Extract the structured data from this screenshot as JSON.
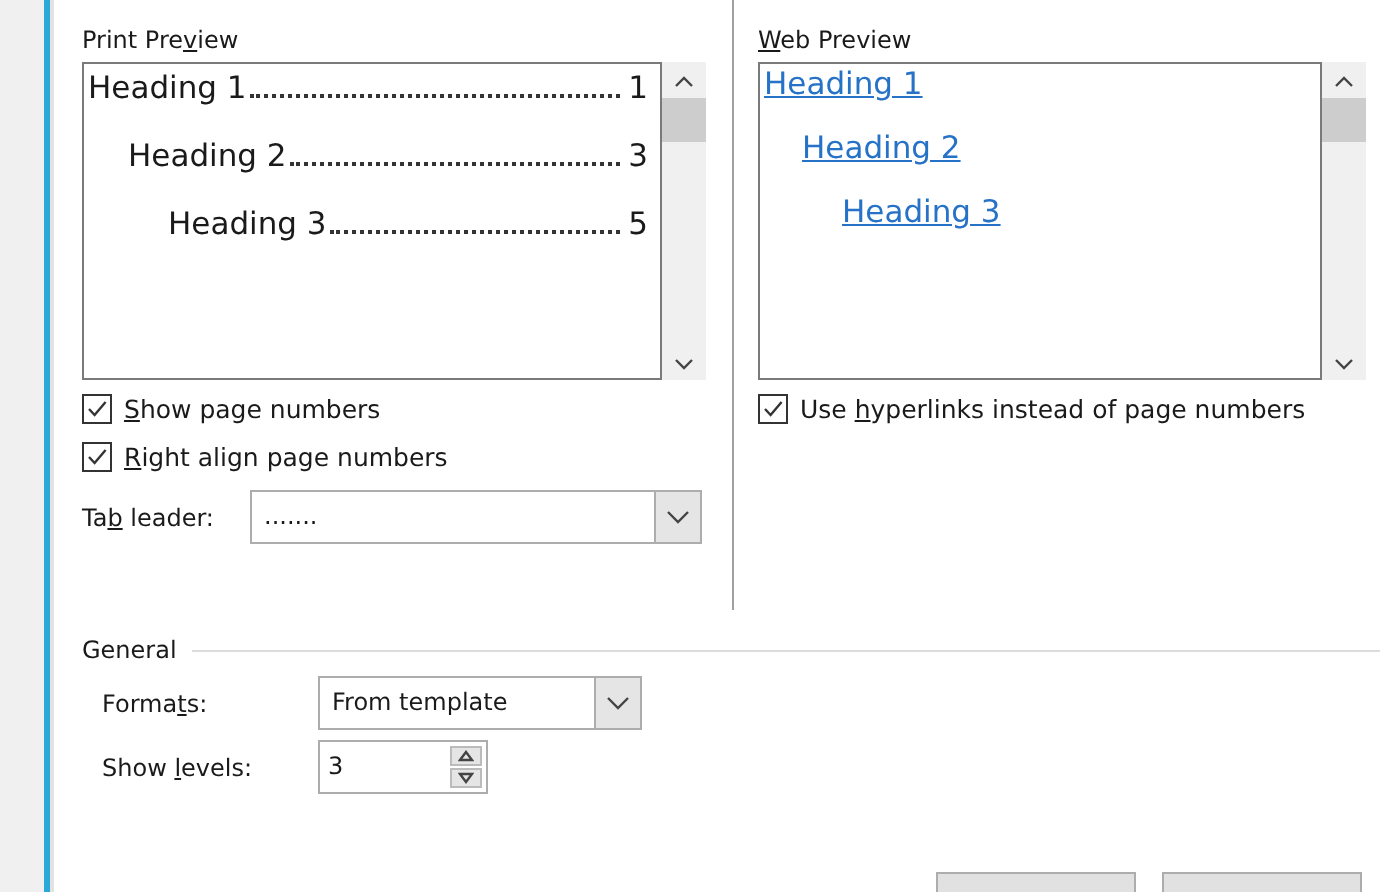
{
  "print_preview": {
    "label": {
      "before": "Print Pre",
      "key": "v",
      "after": "iew"
    },
    "entries": [
      {
        "text": "Heading 1",
        "page": "1"
      },
      {
        "text": "Heading 2",
        "page": "3"
      },
      {
        "text": "Heading 3",
        "page": "5"
      }
    ]
  },
  "print_options": [
    {
      "label": {
        "key": "S",
        "after": "how page numbers"
      },
      "checked": true
    },
    {
      "label": {
        "key": "R",
        "after": "ight align page numbers"
      },
      "checked": true
    }
  ],
  "tab_leader": {
    "label": {
      "before": "Ta",
      "key": "b",
      "after": " leader:"
    },
    "value": "......."
  },
  "web_preview": {
    "label": {
      "key": "W",
      "after": "eb Preview"
    },
    "entries": [
      {
        "text": "Heading 1"
      },
      {
        "text": "Heading 2"
      },
      {
        "text": "Heading 3"
      }
    ]
  },
  "web_options": [
    {
      "label": {
        "before": "Use ",
        "key": "h",
        "after": "yperlinks instead of page numbers"
      },
      "checked": true
    }
  ],
  "general": {
    "title": "General",
    "formats": {
      "label": {
        "before": "Forma",
        "key": "t",
        "after": "s:"
      },
      "value": "From template"
    },
    "show_levels": {
      "label": {
        "before": "Show ",
        "key": "l",
        "after": "evels:"
      },
      "value": "3"
    }
  }
}
